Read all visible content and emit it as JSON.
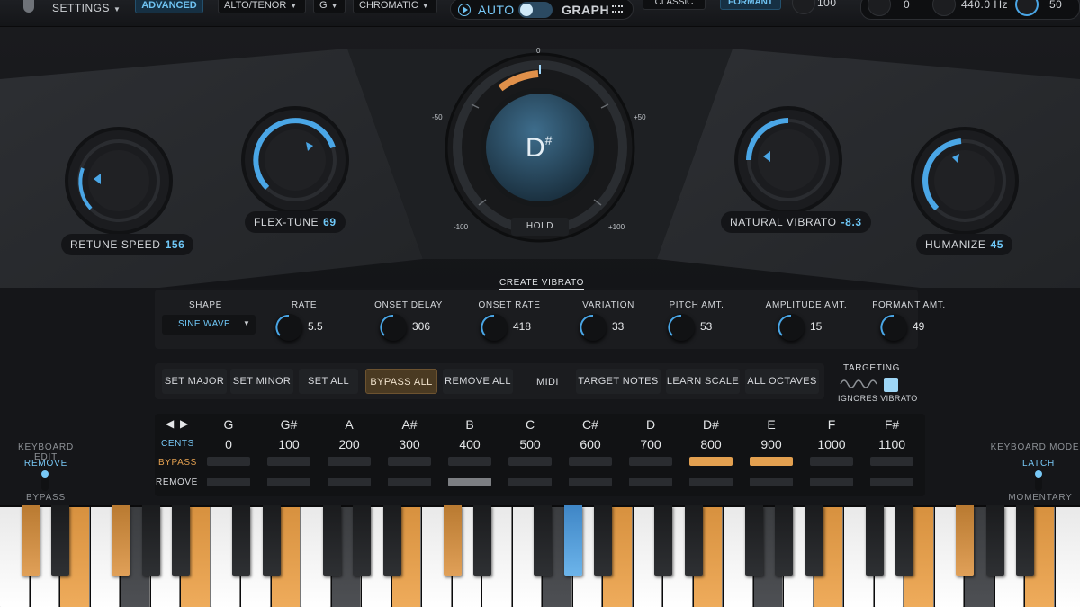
{
  "topbar": {
    "settings_label": "SETTINGS",
    "mode_label": "ADVANCED",
    "voice_select": "ALTO/TENOR",
    "key_select": "G",
    "scale_select": "CHROMATIC",
    "auto_label": "AUTO",
    "graph_label": "GRAPH",
    "classic_label": "CLASSIC",
    "formant_label": "FORMANT",
    "formant_value": "100",
    "transpose_value": "0",
    "reference_freq": "440.0 Hz",
    "right_value": "50"
  },
  "knobs": {
    "retune_speed": {
      "label": "RETUNE SPEED",
      "value": "156"
    },
    "flex_tune": {
      "label": "FLEX-TUNE",
      "value": "69"
    },
    "natural_vibrato": {
      "label": "NATURAL VIBRATO",
      "value": "-8.3"
    },
    "humanize": {
      "label": "HUMANIZE",
      "value": "45"
    }
  },
  "pitch_meter": {
    "note": "D",
    "accidental": "#",
    "scale_top": "0",
    "scale_left": "-50",
    "scale_right": "+50",
    "scale_bottom_left": "-100",
    "scale_bottom_right": "+100",
    "hold_label": "HOLD"
  },
  "vibrato": {
    "title": "CREATE VIBRATO",
    "shape_label": "SHAPE",
    "shape_value": "SINE WAVE",
    "params": [
      {
        "label": "RATE",
        "value": "5.5"
      },
      {
        "label": "ONSET DELAY",
        "value": "306"
      },
      {
        "label": "ONSET RATE",
        "value": "418"
      },
      {
        "label": "VARIATION",
        "value": "33"
      },
      {
        "label": "PITCH AMT.",
        "value": "53"
      },
      {
        "label": "AMPLITUDE AMT.",
        "value": "15"
      },
      {
        "label": "FORMANT AMT.",
        "value": "49"
      }
    ]
  },
  "scale_buttons": {
    "set_major": "SET MAJOR",
    "set_minor": "SET MINOR",
    "set_all": "SET ALL",
    "bypass_all": "BYPASS ALL",
    "remove_all": "REMOVE ALL",
    "midi": "MIDI",
    "target_notes": "TARGET NOTES",
    "learn_scale": "LEARN SCALE",
    "all_octaves": "ALL OCTAVES",
    "targeting": "TARGETING",
    "ignores_vibrato": "IGNORES VIBRATO"
  },
  "note_grid": {
    "cents_label": "CENTS",
    "bypass_label": "BYPASS",
    "remove_label": "REMOVE",
    "notes": [
      "G",
      "G#",
      "A",
      "A#",
      "B",
      "C",
      "C#",
      "D",
      "D#",
      "E",
      "F",
      "F#"
    ],
    "cents": [
      "0",
      "100",
      "200",
      "300",
      "400",
      "500",
      "600",
      "700",
      "800",
      "900",
      "1000",
      "1100"
    ],
    "bypass_on": [
      false,
      false,
      false,
      false,
      false,
      false,
      false,
      false,
      true,
      true,
      false,
      false
    ],
    "remove_on": [
      false,
      false,
      false,
      false,
      true,
      false,
      false,
      false,
      false,
      false,
      false,
      false
    ]
  },
  "side": {
    "keyboard_edit": "KEYBOARD EDIT",
    "remove": "REMOVE",
    "bypass": "BYPASS",
    "keyboard_mode": "KEYBOARD MODE",
    "latch": "LATCH",
    "momentary": "MOMENTARY"
  },
  "colors": {
    "accent_blue": "#4aa6e6",
    "accent_orange": "#e3a050",
    "panel": "#2a2c30"
  }
}
